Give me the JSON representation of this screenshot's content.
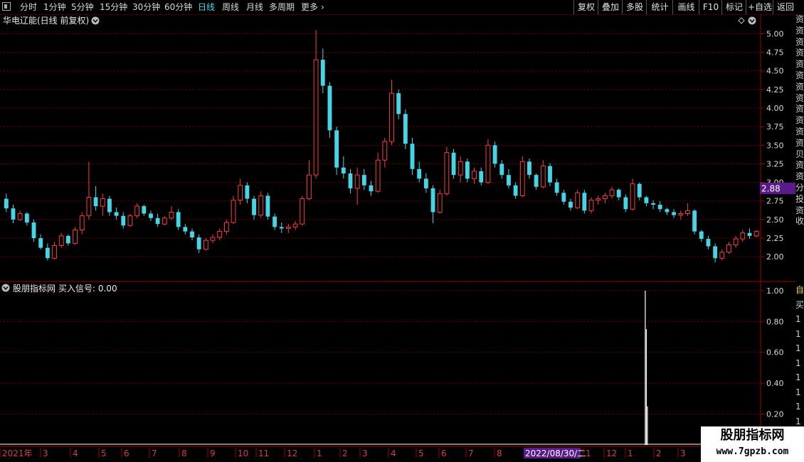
{
  "toolbar": {
    "period_buttons": [
      "分时",
      "1分钟",
      "5分钟",
      "15分钟",
      "30分钟",
      "60分钟",
      "日线",
      "周线",
      "月线",
      "多周期",
      "更多"
    ],
    "active_period": "日线",
    "right_buttons": [
      "复权",
      "叠加",
      "多股",
      "统计",
      "画线",
      "F10",
      "标记",
      "+自选",
      "返回"
    ]
  },
  "main_panel": {
    "title": "华电辽能(日线 前复权)",
    "last_price": "2.88",
    "price_ticks": [
      "5.00",
      "4.75",
      "4.50",
      "4.25",
      "4.00",
      "3.75",
      "3.50",
      "3.25",
      "3.00",
      "2.75",
      "2.50",
      "2.25",
      "2.00"
    ]
  },
  "indicator_panel": {
    "title": "股朋指标网",
    "signal_label": "买入信号: 0.00",
    "value_ticks": [
      "1.00",
      "0.80",
      "0.60",
      "0.40",
      "0.20"
    ]
  },
  "time_axis": {
    "labels": [
      "2021年",
      "3",
      "4",
      "5",
      "6",
      "7",
      "8",
      "9",
      "10",
      "11",
      "12",
      "1",
      "2",
      "3",
      "4",
      "5",
      "6",
      "7",
      "8",
      "2022/08/30/二",
      "1",
      "12",
      "1",
      "2",
      "3"
    ],
    "highlight": "2022/08/30/二"
  },
  "watermark": {
    "line1": "股朋指标网",
    "line2": "www.7gpzb.com"
  },
  "sidebar_chars": [
    "资",
    "资",
    "资",
    "资",
    "资",
    "资",
    "资",
    "资",
    "资",
    "资",
    "资",
    "资",
    "贝",
    "资",
    "资",
    "分",
    "投",
    "资",
    "收"
  ],
  "sidebar2_chars": [
    "自",
    "买",
    "1",
    "1",
    "1",
    "1",
    "1",
    "1",
    "1",
    "1"
  ],
  "colors": {
    "up": "#ff3b3b",
    "down": "#3fd8e8",
    "grid": "#6a0000",
    "axis": "#a00000",
    "price_tag_bg": "#5a1a8c"
  },
  "chart_data": {
    "type": "candlestick",
    "title": "华电辽能(日线 前复权)",
    "ylim": [
      1.82,
      5.1
    ],
    "candles": [
      [
        2.78,
        2.85,
        2.6,
        2.65
      ],
      [
        2.65,
        2.7,
        2.45,
        2.5
      ],
      [
        2.5,
        2.62,
        2.48,
        2.58
      ],
      [
        2.58,
        2.6,
        2.42,
        2.46
      ],
      [
        2.46,
        2.5,
        2.2,
        2.25
      ],
      [
        2.25,
        2.3,
        2.1,
        2.12
      ],
      [
        2.12,
        2.18,
        1.95,
        1.98
      ],
      [
        1.98,
        2.2,
        1.96,
        2.15
      ],
      [
        2.15,
        2.32,
        2.12,
        2.28
      ],
      [
        2.28,
        2.3,
        2.15,
        2.18
      ],
      [
        2.18,
        2.4,
        2.16,
        2.36
      ],
      [
        2.36,
        2.6,
        2.3,
        2.55
      ],
      [
        2.55,
        3.28,
        2.5,
        2.8
      ],
      [
        2.8,
        2.95,
        2.62,
        2.68
      ],
      [
        2.68,
        2.85,
        2.55,
        2.78
      ],
      [
        2.78,
        2.82,
        2.55,
        2.6
      ],
      [
        2.6,
        2.66,
        2.5,
        2.55
      ],
      [
        2.55,
        2.6,
        2.38,
        2.42
      ],
      [
        2.42,
        2.58,
        2.4,
        2.55
      ],
      [
        2.55,
        2.72,
        2.52,
        2.68
      ],
      [
        2.68,
        2.7,
        2.55,
        2.58
      ],
      [
        2.58,
        2.62,
        2.48,
        2.52
      ],
      [
        2.52,
        2.58,
        2.4,
        2.44
      ],
      [
        2.44,
        2.55,
        2.42,
        2.52
      ],
      [
        2.52,
        2.68,
        2.5,
        2.6
      ],
      [
        2.6,
        2.64,
        2.36,
        2.4
      ],
      [
        2.4,
        2.44,
        2.3,
        2.34
      ],
      [
        2.34,
        2.38,
        2.22,
        2.26
      ],
      [
        2.26,
        2.3,
        2.05,
        2.1
      ],
      [
        2.1,
        2.25,
        2.08,
        2.22
      ],
      [
        2.22,
        2.3,
        2.18,
        2.26
      ],
      [
        2.26,
        2.38,
        2.22,
        2.34
      ],
      [
        2.34,
        2.5,
        2.3,
        2.46
      ],
      [
        2.46,
        2.82,
        2.44,
        2.76
      ],
      [
        2.76,
        3.05,
        2.7,
        2.96
      ],
      [
        2.96,
        3.0,
        2.72,
        2.78
      ],
      [
        2.78,
        2.82,
        2.5,
        2.56
      ],
      [
        2.56,
        2.88,
        2.52,
        2.82
      ],
      [
        2.82,
        2.86,
        2.5,
        2.54
      ],
      [
        2.54,
        2.58,
        2.36,
        2.4
      ],
      [
        2.4,
        2.46,
        2.32,
        2.38
      ],
      [
        2.38,
        2.44,
        2.32,
        2.4
      ],
      [
        2.4,
        2.48,
        2.36,
        2.44
      ],
      [
        2.44,
        2.82,
        2.42,
        2.78
      ],
      [
        2.78,
        3.3,
        2.76,
        3.1
      ],
      [
        3.1,
        5.05,
        3.05,
        4.65
      ],
      [
        4.65,
        4.8,
        4.2,
        4.3
      ],
      [
        4.3,
        4.35,
        3.6,
        3.7
      ],
      [
        3.7,
        3.75,
        3.1,
        3.2
      ],
      [
        3.2,
        3.35,
        3.05,
        3.12
      ],
      [
        3.12,
        3.18,
        2.85,
        2.92
      ],
      [
        2.92,
        3.2,
        2.7,
        3.1
      ],
      [
        3.1,
        3.18,
        2.9,
        2.96
      ],
      [
        2.96,
        3.02,
        2.82,
        2.88
      ],
      [
        2.88,
        3.4,
        2.86,
        3.3
      ],
      [
        3.3,
        3.6,
        3.2,
        3.55
      ],
      [
        3.55,
        4.38,
        3.5,
        4.2
      ],
      [
        4.2,
        4.25,
        3.85,
        3.92
      ],
      [
        3.92,
        3.98,
        3.45,
        3.52
      ],
      [
        3.52,
        3.6,
        3.1,
        3.18
      ],
      [
        3.18,
        3.28,
        3.0,
        3.05
      ],
      [
        3.05,
        3.12,
        2.86,
        2.92
      ],
      [
        2.92,
        2.96,
        2.45,
        2.6
      ],
      [
        2.6,
        2.9,
        2.58,
        2.85
      ],
      [
        2.85,
        3.48,
        2.82,
        3.4
      ],
      [
        3.4,
        3.45,
        3.05,
        3.1
      ],
      [
        3.1,
        3.35,
        3.0,
        3.28
      ],
      [
        3.28,
        3.32,
        3.0,
        3.05
      ],
      [
        3.05,
        3.2,
        2.98,
        3.15
      ],
      [
        3.15,
        3.2,
        2.96,
        3.0
      ],
      [
        3.0,
        3.58,
        2.98,
        3.5
      ],
      [
        3.5,
        3.55,
        3.2,
        3.25
      ],
      [
        3.25,
        3.3,
        3.05,
        3.1
      ],
      [
        3.1,
        3.18,
        2.92,
        2.96
      ],
      [
        2.96,
        3.0,
        2.78,
        2.82
      ],
      [
        2.82,
        3.35,
        2.8,
        3.28
      ],
      [
        3.28,
        3.32,
        3.05,
        3.1
      ],
      [
        3.1,
        3.12,
        2.9,
        2.94
      ],
      [
        2.94,
        3.3,
        2.92,
        3.22
      ],
      [
        3.22,
        3.26,
        2.95,
        3.0
      ],
      [
        3.0,
        3.05,
        2.82,
        2.86
      ],
      [
        2.86,
        2.9,
        2.7,
        2.74
      ],
      [
        2.74,
        2.78,
        2.62,
        2.66
      ],
      [
        2.66,
        2.9,
        2.64,
        2.86
      ],
      [
        2.86,
        2.9,
        2.58,
        2.62
      ],
      [
        2.62,
        2.8,
        2.58,
        2.76
      ],
      [
        2.76,
        2.82,
        2.7,
        2.78
      ],
      [
        2.78,
        2.86,
        2.72,
        2.82
      ],
      [
        2.82,
        2.94,
        2.78,
        2.9
      ],
      [
        2.9,
        2.92,
        2.76,
        2.8
      ],
      [
        2.8,
        2.84,
        2.6,
        2.64
      ],
      [
        2.64,
        3.05,
        2.62,
        2.98
      ],
      [
        2.98,
        3.0,
        2.76,
        2.8
      ],
      [
        2.8,
        2.82,
        2.68,
        2.72
      ],
      [
        2.72,
        2.76,
        2.64,
        2.7
      ],
      [
        2.7,
        2.75,
        2.6,
        2.64
      ],
      [
        2.64,
        2.66,
        2.56,
        2.6
      ],
      [
        2.6,
        2.64,
        2.52,
        2.56
      ],
      [
        2.56,
        2.62,
        2.5,
        2.58
      ],
      [
        2.58,
        2.72,
        2.55,
        2.62
      ],
      [
        2.62,
        2.64,
        2.3,
        2.34
      ],
      [
        2.34,
        2.36,
        2.2,
        2.24
      ],
      [
        2.24,
        2.28,
        2.1,
        2.14
      ],
      [
        2.14,
        2.18,
        1.92,
        1.98
      ],
      [
        1.98,
        2.1,
        1.95,
        2.06
      ],
      [
        2.06,
        2.2,
        2.04,
        2.16
      ],
      [
        2.16,
        2.28,
        2.12,
        2.24
      ],
      [
        2.24,
        2.36,
        2.2,
        2.32
      ],
      [
        2.32,
        2.38,
        2.24,
        2.28
      ],
      [
        2.28,
        2.36,
        2.26,
        2.34
      ]
    ],
    "indicator": {
      "name": "买入信号",
      "ylim": [
        0,
        1.05
      ],
      "x_index": 93,
      "values": [
        1.0,
        0.75,
        0.25
      ]
    }
  }
}
